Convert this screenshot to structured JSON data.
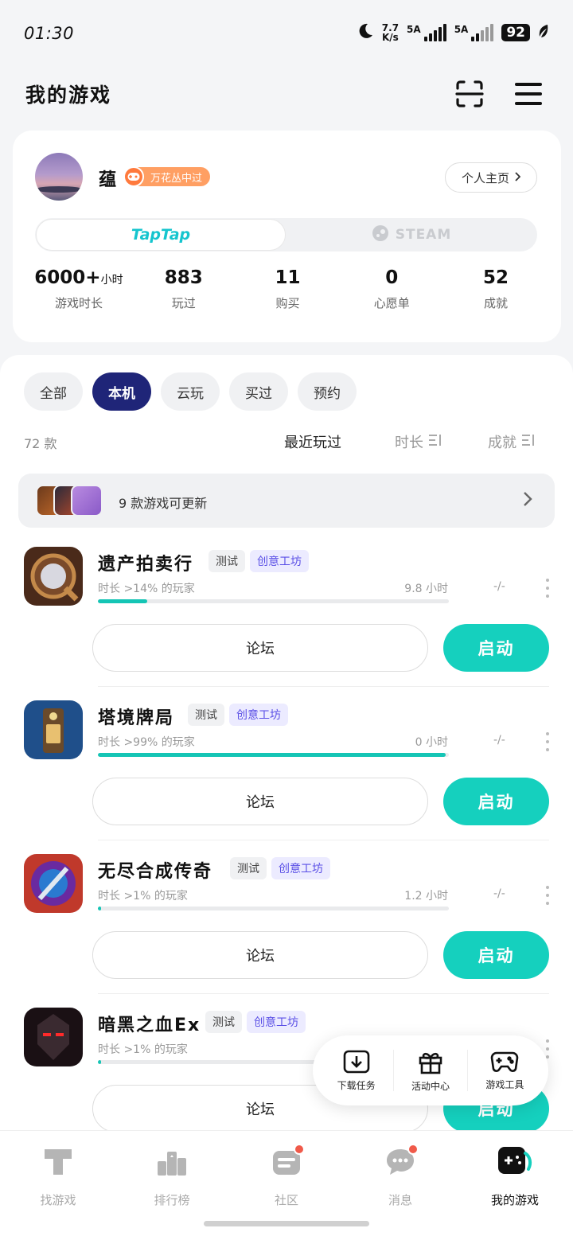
{
  "status": {
    "time": "01:30",
    "speed_top": "7.7",
    "speed_bottom": "K/s",
    "sim1": "5A",
    "sim2": "5A",
    "battery": "92"
  },
  "header": {
    "title": "我的游戏"
  },
  "profile": {
    "username": "蕴",
    "badge": "万花丛中过",
    "profile_link": "个人主页",
    "platforms": {
      "taptap": "TapTap",
      "steam": "STEAM"
    },
    "stats": [
      {
        "value": "6000+",
        "unit": "小时",
        "label": "游戏时长"
      },
      {
        "value": "883",
        "unit": "",
        "label": "玩过"
      },
      {
        "value": "11",
        "unit": "",
        "label": "购买"
      },
      {
        "value": "0",
        "unit": "",
        "label": "心愿单"
      },
      {
        "value": "52",
        "unit": "",
        "label": "成就"
      }
    ]
  },
  "filters": {
    "tabs": [
      "全部",
      "本机",
      "云玩",
      "买过",
      "预约"
    ],
    "active": "本机"
  },
  "list": {
    "count": "72 款",
    "sort": {
      "recent": "最近玩过",
      "duration": "时长",
      "achievement": "成就"
    },
    "update_banner": "9 款游戏可更新"
  },
  "games": [
    {
      "name": "遗产拍卖行",
      "tag_test": "测试",
      "tag_workshop": "创意工坊",
      "meta": "时长 >14% 的玩家",
      "hours": "9.8 小时",
      "achievement": "-/-",
      "progress": 0.14
    },
    {
      "name": "塔境牌局",
      "tag_test": "测试",
      "tag_workshop": "创意工坊",
      "meta": "时长 >99% 的玩家",
      "hours": "0 小时",
      "achievement": "-/-",
      "progress": 0.99
    },
    {
      "name": "无尽合成传奇",
      "tag_test": "测试",
      "tag_workshop": "创意工坊",
      "meta": "时长 >1% 的玩家",
      "hours": "1.2 小时",
      "achievement": "-/-",
      "progress": 0.01
    },
    {
      "name": "暗黑之血Ex",
      "tag_test": "测试",
      "tag_workshop": "创意工坊",
      "meta": "时长 >1% 的玩家",
      "hours": "",
      "achievement": "",
      "progress": 0.01
    }
  ],
  "game_buttons": {
    "forum": "论坛",
    "launch": "启动"
  },
  "float_bar": {
    "download": "下载任务",
    "events": "活动中心",
    "tools": "游戏工具"
  },
  "nav": {
    "find": "找游戏",
    "rank": "排行榜",
    "community": "社区",
    "messages": "消息",
    "mine": "我的游戏"
  },
  "colors": {
    "accent": "#15d0be",
    "active_tab": "#1f2578",
    "workshop": "#5a4fe6",
    "badge": "#ff9f63"
  }
}
